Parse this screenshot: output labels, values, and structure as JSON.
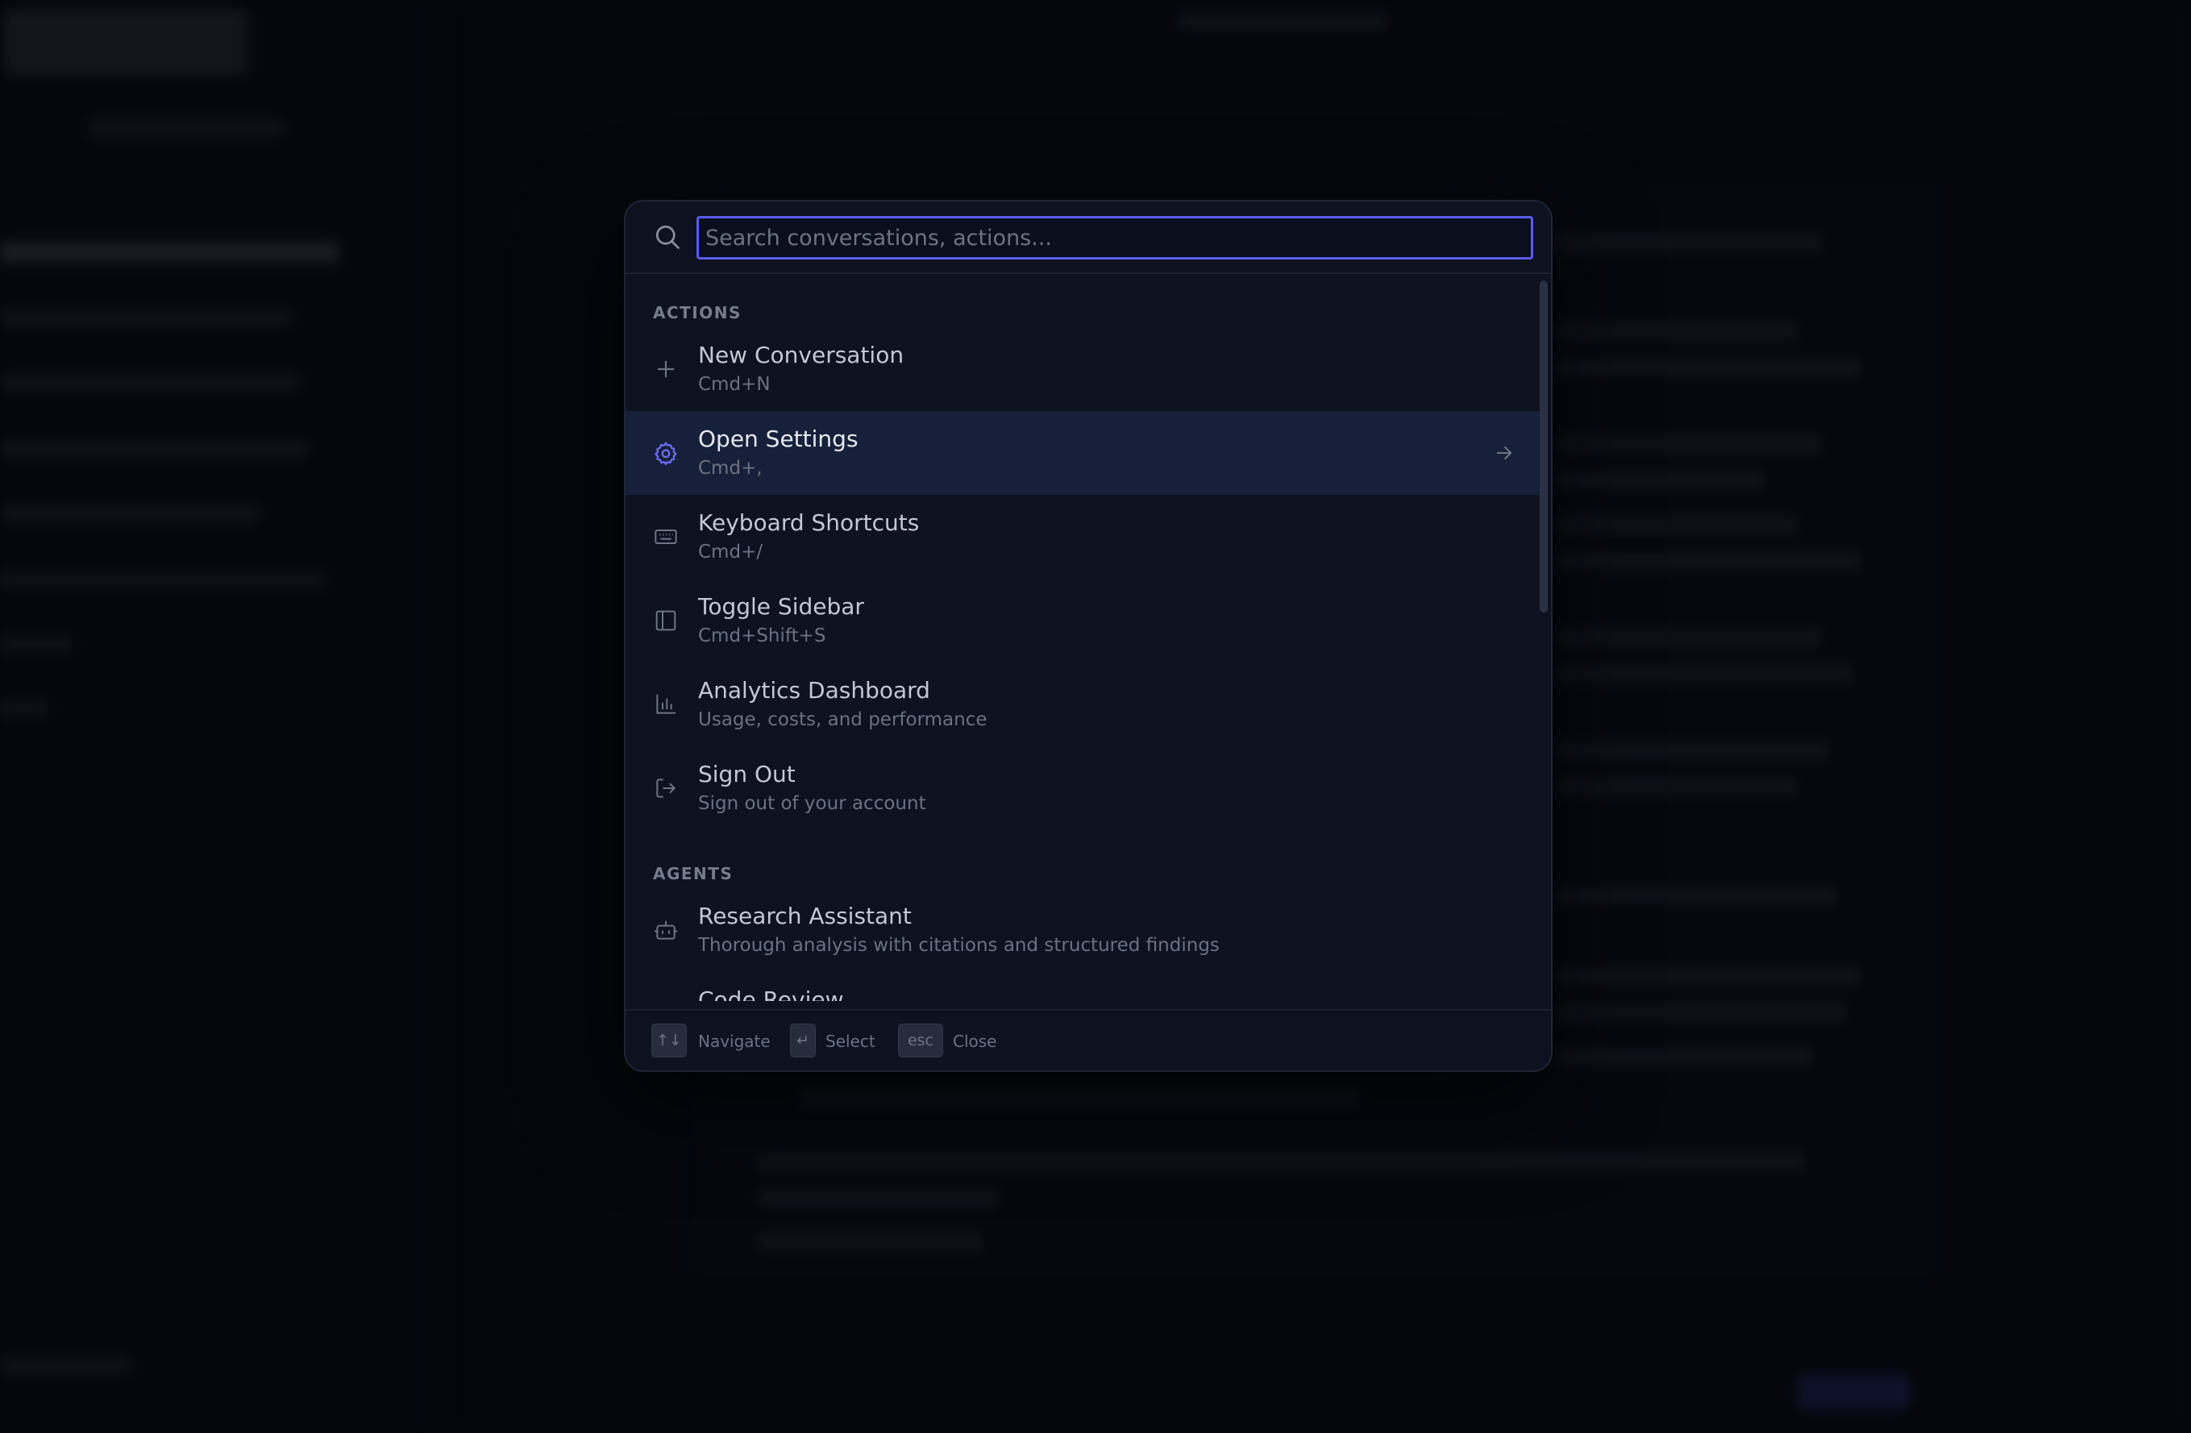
{
  "palette": {
    "search": {
      "placeholder": "Search conversations, actions...",
      "value": ""
    },
    "sections": [
      {
        "label": "ACTIONS",
        "items": [
          {
            "title": "New Conversation",
            "subtitle": "Cmd+N",
            "icon": "plus-icon"
          },
          {
            "title": "Open Settings",
            "subtitle": "Cmd+,",
            "icon": "gear-icon",
            "active": true
          },
          {
            "title": "Keyboard Shortcuts",
            "subtitle": "Cmd+/",
            "icon": "keyboard-icon"
          },
          {
            "title": "Toggle Sidebar",
            "subtitle": "Cmd+Shift+S",
            "icon": "sidebar-icon"
          },
          {
            "title": "Analytics Dashboard",
            "subtitle": "Usage, costs, and performance",
            "icon": "bar-chart-icon"
          },
          {
            "title": "Sign Out",
            "subtitle": "Sign out of your account",
            "icon": "logout-icon"
          }
        ]
      },
      {
        "label": "AGENTS",
        "items": [
          {
            "title": "Research Assistant",
            "subtitle": "Thorough analysis with citations and structured findings",
            "icon": "bot-icon"
          },
          {
            "title": "Code Review",
            "subtitle": "",
            "icon": "code-icon"
          }
        ]
      }
    ],
    "footer": {
      "navigate_key": "↑↓",
      "navigate_label": "Navigate",
      "select_key": "↵",
      "select_label": "Select",
      "close_key": "esc",
      "close_label": "Close"
    }
  },
  "colors": {
    "accent": "#5b5cf0",
    "active_row": "#17203a",
    "panel": "#0d1120",
    "backdrop": "#080a12"
  }
}
